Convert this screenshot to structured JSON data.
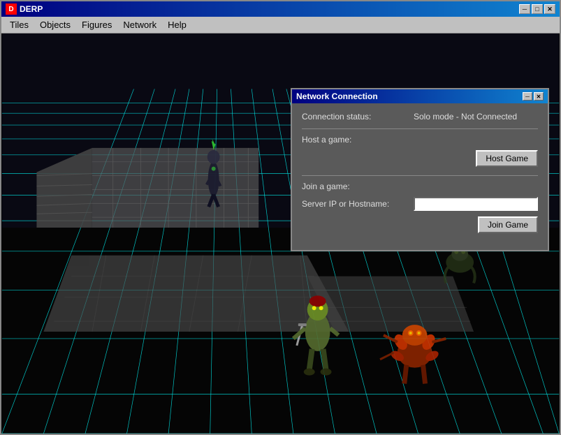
{
  "window": {
    "title": "DERP",
    "title_icon_text": "D",
    "minimize_btn": "─",
    "maximize_btn": "□",
    "close_btn": "✕"
  },
  "menu": {
    "items": [
      "Tiles",
      "Objects",
      "Figures",
      "Network",
      "Help"
    ]
  },
  "dialog": {
    "title": "Network Connection",
    "close_btn": "✕",
    "minimize_btn": "─",
    "connection_status_label": "Connection status:",
    "connection_status_value": "Solo mode - Not Connected",
    "host_game_label": "Host a game:",
    "host_game_button": "Host Game",
    "join_game_label": "Join a game:",
    "server_ip_label": "Server IP or Hostname:",
    "server_ip_placeholder": "",
    "join_game_button": "Join Game"
  },
  "colors": {
    "grid": "#00ffff",
    "background": "#000000",
    "dialog_bg": "#5a5a5a",
    "titlebar_start": "#000080",
    "titlebar_end": "#1084d0"
  }
}
